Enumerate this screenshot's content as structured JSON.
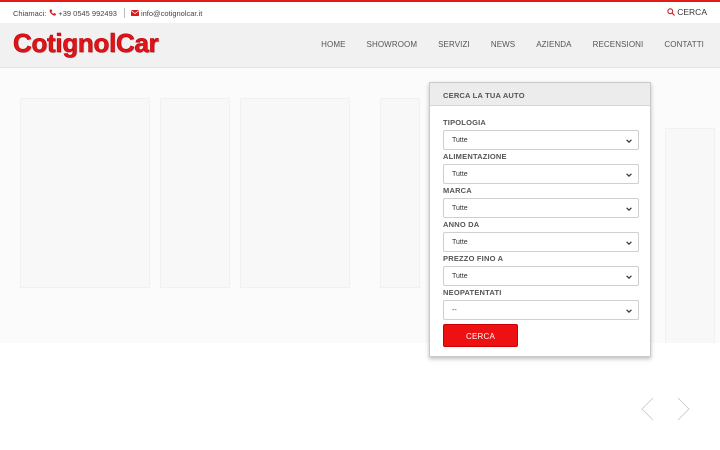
{
  "topbar": {
    "call_label": "Chiamaci:",
    "phone": "+39 0545 992493",
    "email": "info@cotignolcar.it",
    "search_label": "CERCA"
  },
  "header": {
    "logo": "CotignolCar",
    "nav": [
      "HOME",
      "SHOWROOM",
      "SERVIZI",
      "NEWS",
      "AZIENDA",
      "RECENSIONI",
      "CONTATTI"
    ]
  },
  "search_panel": {
    "title": "CERCA LA TUA AUTO",
    "fields": [
      {
        "label": "TIPOLOGIA",
        "value": "Tutte"
      },
      {
        "label": "ALIMENTAZIONE",
        "value": "Tutte"
      },
      {
        "label": "MARCA",
        "value": "Tutte"
      },
      {
        "label": "ANNO DA",
        "value": "Tutte"
      },
      {
        "label": "PREZZO FINO A",
        "value": "Tutte"
      },
      {
        "label": "NEOPATENTATI",
        "value": "--"
      }
    ],
    "submit_label": "CERCA"
  },
  "colors": {
    "accent": "#e0141b",
    "button": "#ee1111"
  },
  "icons": [
    "phone-icon",
    "envelope-icon",
    "search-icon",
    "chevron-down-icon",
    "slider-prev-icon",
    "slider-next-icon"
  ]
}
